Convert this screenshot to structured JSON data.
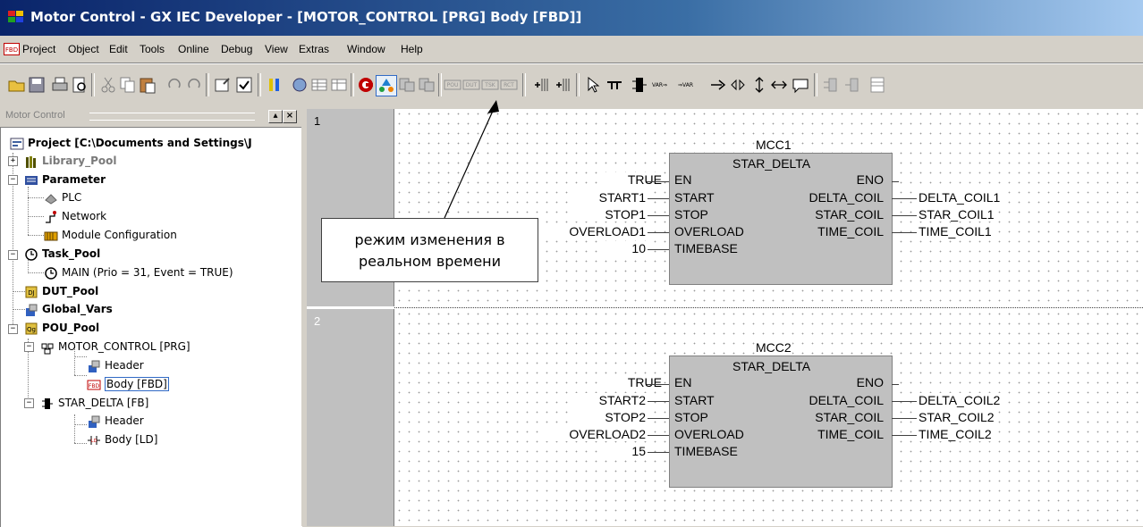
{
  "window": {
    "title": "Motor Control - GX IEC Developer - [MOTOR_CONTROL [PRG] Body [FBD]]"
  },
  "menu": [
    "Project",
    "Object",
    "Edit",
    "Tools",
    "Online",
    "Debug",
    "View",
    "Extras",
    "Window",
    "Help"
  ],
  "toolbar_icons": [
    "open-icon",
    "save-icon",
    "print-icon",
    "print-preview-icon",
    "cut-icon",
    "copy-icon",
    "paste-icon",
    "undo-icon",
    "redo-icon",
    "properties-icon",
    "check-icon",
    "compile-icon",
    "build-icon",
    "online-change-icon",
    "monitor-icon",
    "transfer-icon",
    "fbd-element-icons",
    "pointer-icon",
    "line-icon",
    "variable-icons",
    "comment-icon"
  ],
  "panel": {
    "title": "Motor Control"
  },
  "tree": {
    "project": "Project [C:\\Documents and Settings\\J",
    "library_pool": "Library_Pool",
    "parameter": "Parameter",
    "plc": "PLC",
    "network": "Network",
    "module_config": "Module Configuration",
    "task_pool": "Task_Pool",
    "main_task": "MAIN (Prio = 31, Event = TRUE)",
    "dut_pool": "DUT_Pool",
    "global_vars": "Global_Vars",
    "pou_pool": "POU_Pool",
    "motor_control": "MOTOR_CONTROL [PRG]",
    "mc_header": "Header",
    "mc_body": "Body [FBD]",
    "star_delta": "STAR_DELTA [FB]",
    "sd_header": "Header",
    "sd_body": "Body [LD]"
  },
  "callout": {
    "line1": "режим изменения в",
    "line2": "реальном времени"
  },
  "networks": [
    {
      "number": "1",
      "instance": "MCC1",
      "fb_type": "STAR_DELTA",
      "inputs": [
        {
          "var": "TRUE",
          "pin": "EN"
        },
        {
          "var": "START1",
          "pin": "START"
        },
        {
          "var": "STOP1",
          "pin": "STOP"
        },
        {
          "var": "OVERLOAD1",
          "pin": "OVERLOAD"
        },
        {
          "var": "10",
          "pin": "TIMEBASE"
        }
      ],
      "outputs": [
        {
          "pin": "ENO",
          "var": ""
        },
        {
          "pin": "DELTA_COIL",
          "var": "DELTA_COIL1"
        },
        {
          "pin": "STAR_COIL",
          "var": "STAR_COIL1"
        },
        {
          "pin": "TIME_COIL",
          "var": "TIME_COIL1"
        }
      ]
    },
    {
      "number": "2",
      "instance": "MCC2",
      "fb_type": "STAR_DELTA",
      "inputs": [
        {
          "var": "TRUE",
          "pin": "EN"
        },
        {
          "var": "START2",
          "pin": "START"
        },
        {
          "var": "STOP2",
          "pin": "STOP"
        },
        {
          "var": "OVERLOAD2",
          "pin": "OVERLOAD"
        },
        {
          "var": "15",
          "pin": "TIMEBASE"
        }
      ],
      "outputs": [
        {
          "pin": "ENO",
          "var": ""
        },
        {
          "pin": "DELTA_COIL",
          "var": "DELTA_COIL2"
        },
        {
          "pin": "STAR_COIL",
          "var": "STAR_COIL2"
        },
        {
          "pin": "TIME_COIL",
          "var": "TIME_COIL2"
        }
      ]
    }
  ]
}
